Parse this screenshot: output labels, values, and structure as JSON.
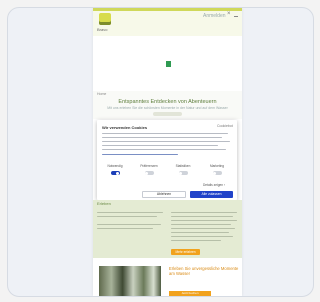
{
  "header": {
    "logo_text": "Bravo",
    "top_link": "Anmelden",
    "close_glyph": "×"
  },
  "section": {
    "label": "Home",
    "headline": "Entspanntes Entdecken von Abenteuern",
    "subline": "Mit uns erleben Sie die schönsten Momente in der Natur und auf dem Wasser",
    "small_tag": ""
  },
  "consent": {
    "title": "Wir verwenden Cookies",
    "brand": "Cookiebot",
    "toggles": [
      {
        "label": "Notwendig",
        "on": true
      },
      {
        "label": "Präferenzen",
        "on": false
      },
      {
        "label": "Statistiken",
        "on": false
      },
      {
        "label": "Marketing",
        "on": false
      }
    ],
    "details_link": "Details zeigen ›",
    "deny_label": "Ablehnen",
    "allow_label": "Alle zulassen"
  },
  "green_section": {
    "title": "Erleben",
    "button_label": "Mehr erfahren"
  },
  "promo": {
    "title": "Erleben Sie unvergessliche Momente am Wasser",
    "button_label": "Jetzt buchen"
  },
  "colors": {
    "accent": "#2042c9",
    "brand_green": "#6a8a45",
    "orange": "#f1a21d",
    "top_accent": "#cfd85a"
  }
}
